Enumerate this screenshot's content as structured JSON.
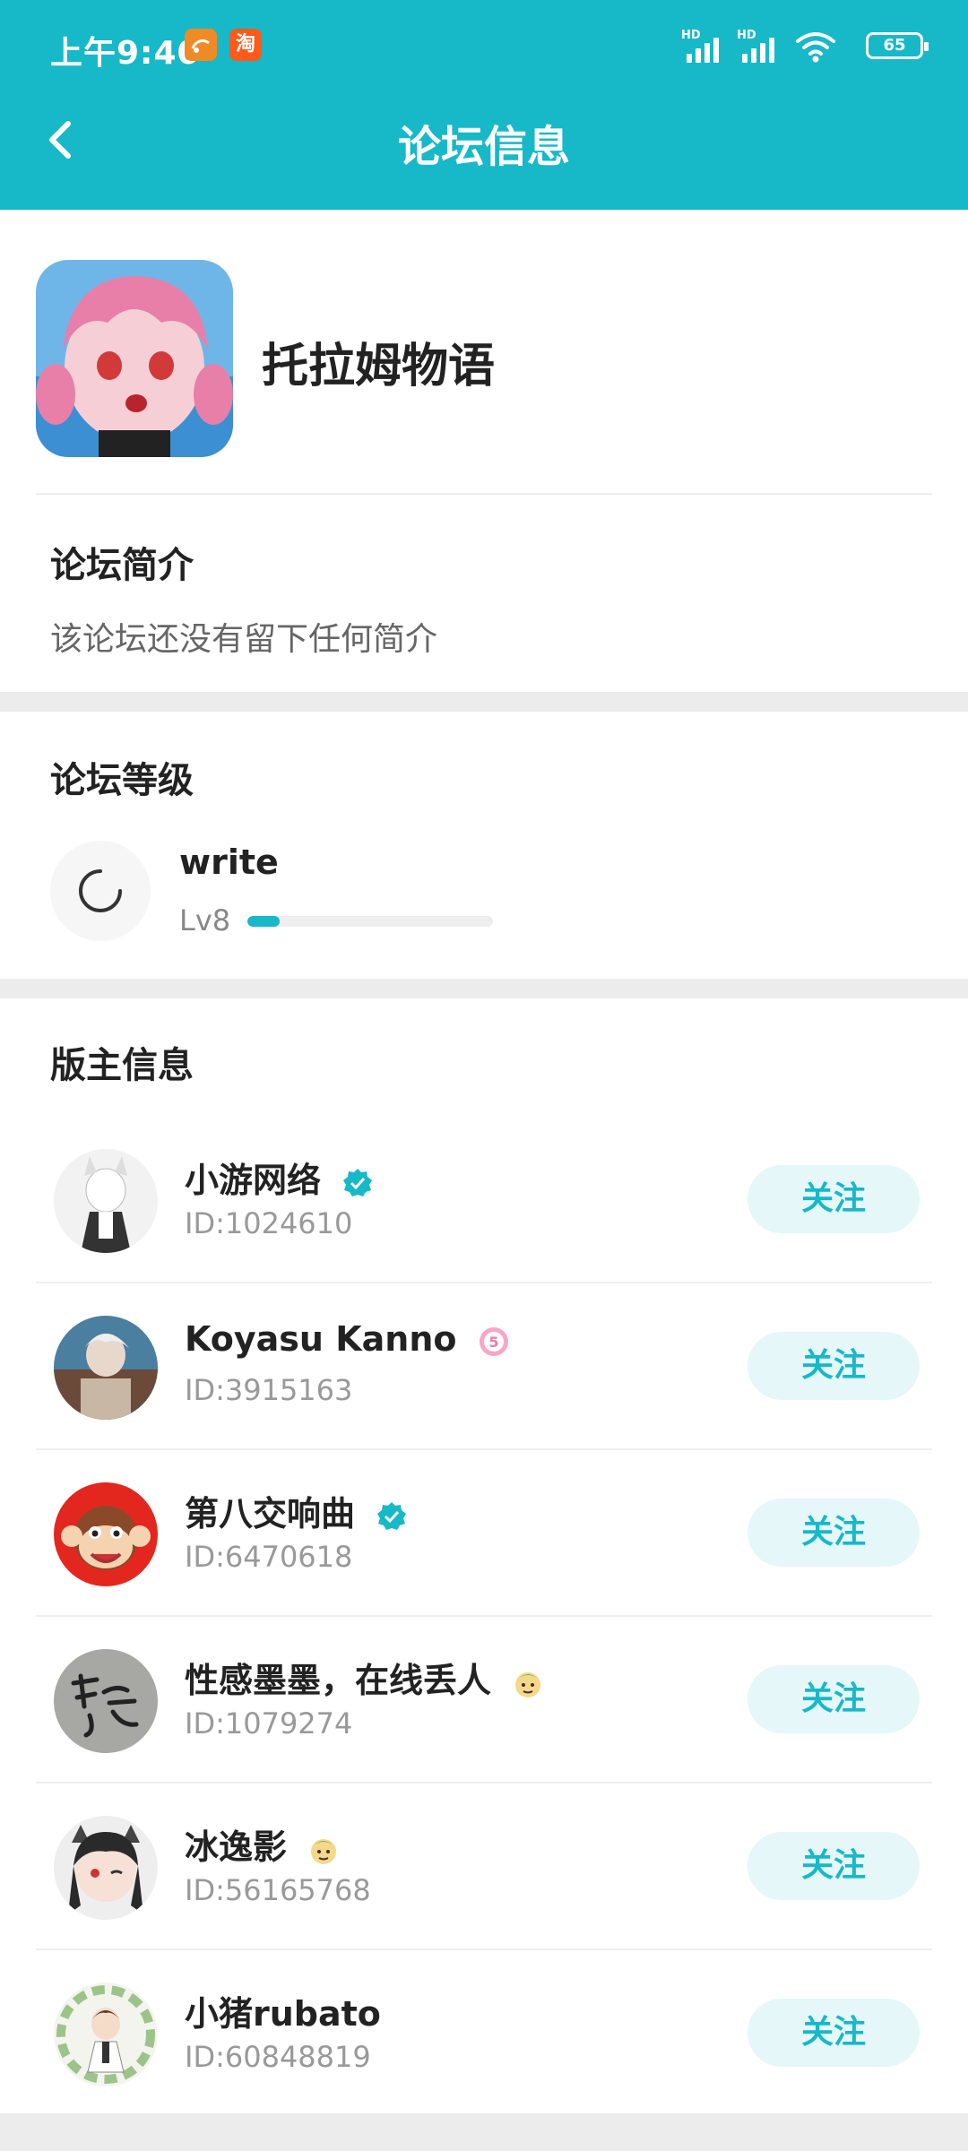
{
  "status_bar": {
    "time": "上午9:40",
    "app_badges": [
      "UC",
      "淘"
    ],
    "signal_labels": [
      "HD",
      "HD"
    ],
    "battery": "65"
  },
  "header": {
    "title": "论坛信息"
  },
  "forum": {
    "name": "托拉姆物语"
  },
  "intro": {
    "title": "论坛简介",
    "text": "该论坛还没有留下任何简介"
  },
  "level": {
    "title": "论坛等级",
    "name": "write",
    "lv": "Lv8",
    "progress": 0.13
  },
  "moderators": {
    "title": "版主信息",
    "follow_label": "关注",
    "items": [
      {
        "name": "小游网络",
        "id": "ID:1024610",
        "badge": "verified-icon"
      },
      {
        "name": "Koyasu Kanno",
        "id": "ID:3915163",
        "badge": "rank-badge-icon"
      },
      {
        "name": "第八交响曲",
        "id": "ID:6470618",
        "badge": "verified-icon"
      },
      {
        "name": "性感墨墨，在线丢人",
        "id": "ID:1079274",
        "badge": "emoji-badge-icon"
      },
      {
        "name": "冰逸影",
        "id": "ID:56165768",
        "badge": "emoji-badge-icon"
      },
      {
        "name": "小猪rubato",
        "id": "ID:60848819",
        "badge": ""
      }
    ]
  },
  "colors": {
    "accent": "#17b8c8",
    "follow_bg": "#e5f7f8"
  }
}
